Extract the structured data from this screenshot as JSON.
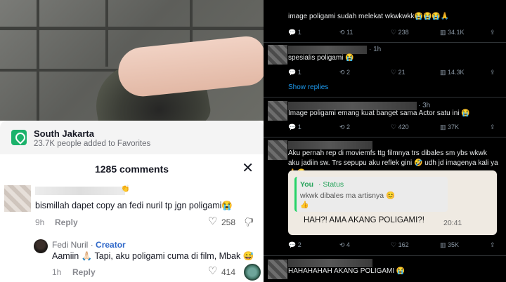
{
  "tiktok": {
    "location": {
      "name": "South Jakarta",
      "favorites": "23.7K people added to Favorites"
    },
    "comments_title": "1285 comments",
    "close_label": "✕",
    "comments": [
      {
        "name_emoji": "👏",
        "text": "bismillah dapet copy an fedi nuril tp jgn poligami😭",
        "age": "9h",
        "reply_label": "Reply",
        "likes": "258"
      },
      {
        "name": "Fedi Nuril",
        "creator_label": "Creator",
        "text": "Aamiin 🙏🏻 Tapi, aku poligami cuma di film, Mbak 😅",
        "age": "1h",
        "reply_label": "Reply",
        "likes": "414"
      }
    ]
  },
  "twitter": {
    "tweets": [
      {
        "time": "",
        "text": "image poligami sudah melekat wkwkwkk😭😭😭🙏",
        "replies": "1",
        "retweets": "11",
        "likes": "238",
        "views": "34.1K"
      },
      {
        "time": "· 1h",
        "text": "spesialis poligami 😭",
        "replies": "1",
        "retweets": "2",
        "likes": "21",
        "views": "14.3K"
      },
      {
        "time": "· 3h",
        "text": "Image poligami emang kuat banget sama Actor satu ini 😭",
        "replies": "1",
        "retweets": "2",
        "likes": "420",
        "views": "37K"
      },
      {
        "time": "",
        "text": "Aku pernah rep di moviemfs ttg filmnya trs dibales sm ybs wkwk aku jadiin sw. Trs sepupu aku reflek gini 🤣 udh jd imagenya kali ya 🙏😂",
        "replies": "2",
        "retweets": "4",
        "likes": "162",
        "views": "35K"
      },
      {
        "time": "",
        "text": "HAHAHAHAH AKANG POLIGAMI 😭"
      }
    ],
    "show_replies": "Show replies",
    "whatsapp": {
      "you": "You",
      "status": "· Status",
      "quoted": "wkwk dibales ma artisnya 😊",
      "quoted_emoji": "👍",
      "message": "HAH?! AMA AKANG POLIGAMI?!",
      "time": "20:41"
    }
  }
}
